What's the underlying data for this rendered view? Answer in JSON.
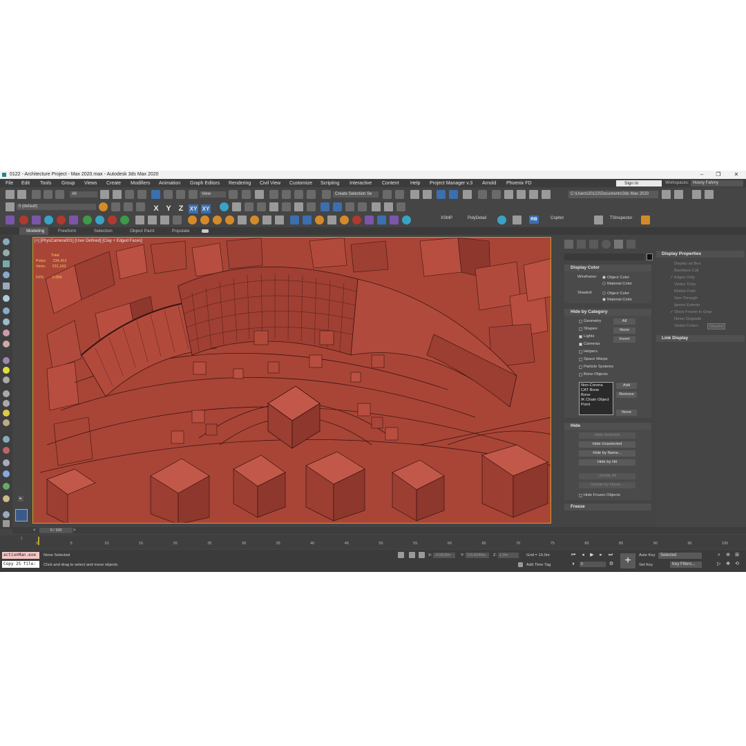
{
  "window": {
    "title": "0122 - Architecture Project - Max 2020.max - Autodesk 3ds Max 2020",
    "minimize": "–",
    "maximize": "❐",
    "close": "✕"
  },
  "menu": [
    "File",
    "Edit",
    "Tools",
    "Group",
    "Views",
    "Create",
    "Modifiers",
    "Animation",
    "Graph Editors",
    "Rendering",
    "Civil View",
    "Customize",
    "Scripting",
    "Interactive",
    "Content",
    "Help",
    "Project Manager v.3",
    "Arnold",
    "Phoenix FD"
  ],
  "signin": "Sign In",
  "workspaces": {
    "label": "Workspaces:",
    "value": "Hosny Fahmy"
  },
  "toolbar1": {
    "selection_filter": "All",
    "ref_coord": "View",
    "named_selection": "Create Selection Se",
    "path": "C:\\Users\\20122\\Documents\\3ds Max 2020"
  },
  "toolbar2": {
    "layer": "0 (default)",
    "axis_x": "X",
    "axis_y": "Y",
    "axis_z": "Z",
    "axis_xy": "XY",
    "axis_xy2": "XY"
  },
  "toolbar3": {
    "xsmp": "XSMP",
    "polydetail": "PolyDetail",
    "rb": "RB",
    "copitor": "Copitor",
    "tsinspector": "TSInspector"
  },
  "ribbon_tabs": [
    "Modeling",
    "Freeform",
    "Selection",
    "Object Paint",
    "Populate"
  ],
  "viewport": {
    "label": "[+] [PhysCamera001] [User Defined] [Clay + Edged Faces]",
    "stats_total": "Total",
    "stats_polys_label": "Polys:",
    "stats_polys": "234,412",
    "stats_verts_label": "Verts:",
    "stats_verts": "231,163",
    "fps_label": "FPS:",
    "fps": "0.056"
  },
  "command_panel": {
    "display_color": {
      "title": "Display Color",
      "wireframe_label": "Wireframe:",
      "shaded_label": "Shaded:",
      "object_color": "Object Color",
      "material_color": "Material Color"
    },
    "hide_by_category": {
      "title": "Hide by Category",
      "items": [
        "Geometry",
        "Shapes",
        "Lights",
        "Cameras",
        "Helpers",
        "Space Warps",
        "Particle Systems",
        "Bone Objects"
      ],
      "checked": [
        false,
        false,
        true,
        true,
        false,
        false,
        false,
        false
      ],
      "all": "All",
      "none": "None",
      "invert": "Invert",
      "list": [
        "Non-Corona",
        "CAT Bone",
        "Bone",
        "IK Chain Object",
        "Point"
      ],
      "add": "Add",
      "remove": "Remove",
      "none2": "None"
    },
    "hide": {
      "title": "Hide",
      "buttons": [
        "Hide Selected",
        "Hide Unselected",
        "Hide by Name...",
        "Hide by Hit",
        "Unhide All",
        "Unhide by Name..."
      ],
      "disabled": [
        true,
        false,
        false,
        false,
        true,
        true
      ],
      "hide_frozen": "Hide Frozen Objects"
    },
    "freeze": {
      "title": "Freeze"
    }
  },
  "display_properties": {
    "title": "Display Properties",
    "items": [
      "Display as Box",
      "Backface Cull",
      "Edges Only",
      "Vertex Ticks",
      "Motion Path",
      "See-Through",
      "Ignore Extents",
      "Show Frozen in Gray",
      "Never Degrade",
      "Vertex Colors"
    ],
    "checked": [
      false,
      false,
      true,
      false,
      false,
      false,
      false,
      true,
      false,
      false
    ],
    "shaded": "Shaded",
    "link_display": "Link Display"
  },
  "timeline": {
    "frame": "0 / 100",
    "prev": "<",
    "next": ">",
    "ticks": [
      "0",
      "5",
      "10",
      "15",
      "20",
      "25",
      "30",
      "35",
      "40",
      "45",
      "50",
      "55",
      "60",
      "65",
      "70",
      "75",
      "80",
      "85",
      "90",
      "95",
      "100"
    ]
  },
  "status": {
    "maxscript_1": "actionMan.exe",
    "maxscript_2": "Copy 25 file:",
    "selection": "None Selected",
    "prompt": "Click and drag to select and move objects",
    "x_label": "X:",
    "x_value": "-4.0818m",
    "y_label": "Y:",
    "y_value": "115.8346m",
    "z_label": "Z:",
    "z_value": "1.0m",
    "grid": "Grid = 10.0m",
    "add_time_tag": "Add Time Tag",
    "auto_key": "Auto Key",
    "selected": "Selected",
    "set_key": "Set Key",
    "key_filters": "Key Filters...",
    "frame_value": "0"
  },
  "colors": {
    "viewport_clay": "#b04a3c",
    "frame_border": "#c9a227",
    "maxscript_bg1": "#f4c7c7",
    "maxscript_bg2": "#ffffff"
  }
}
